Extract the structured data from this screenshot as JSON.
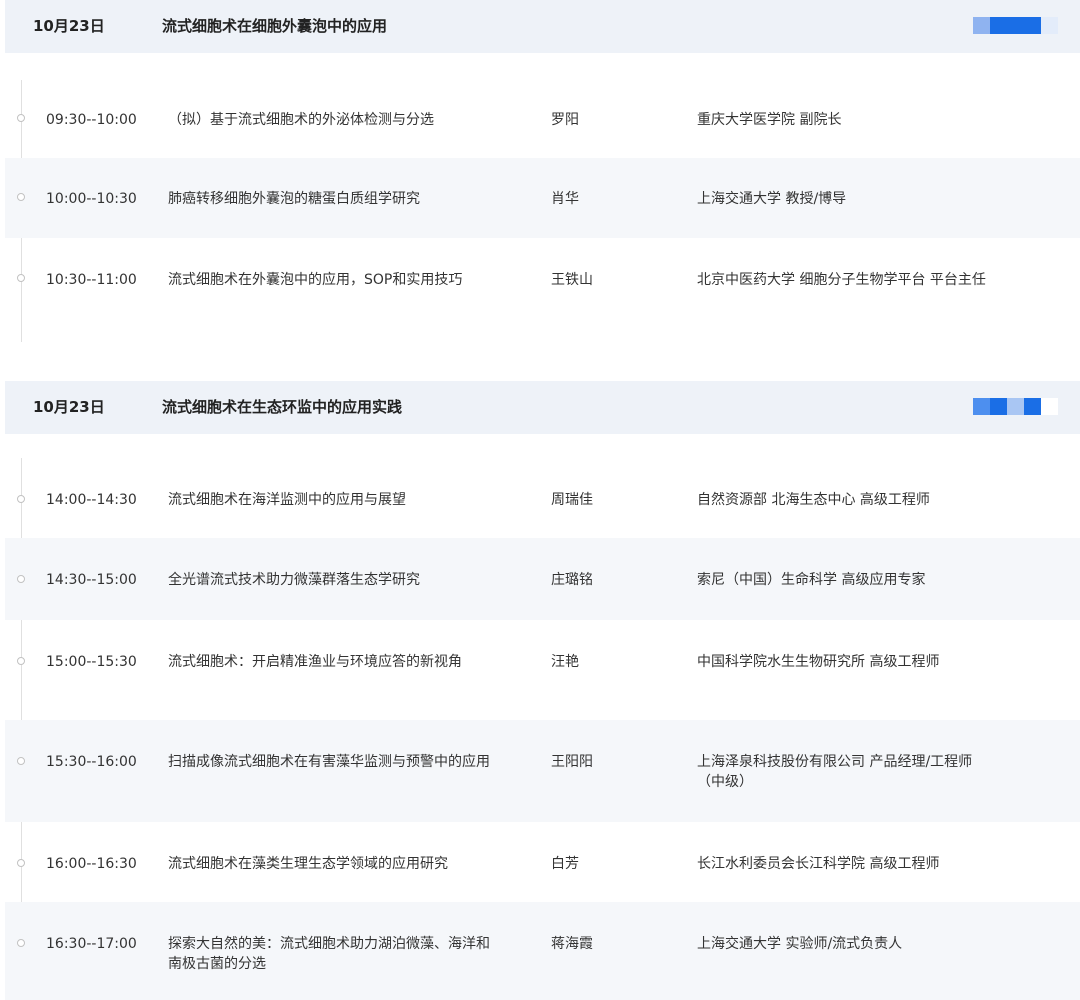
{
  "sections": [
    {
      "date": "10月23日",
      "title": "流式细胞术在细胞外囊泡中的应用",
      "sessions": [
        {
          "time": "09:30--10:00",
          "topic": "（拟）基于流式细胞术的外泌体检测与分选",
          "speaker": "罗阳",
          "org": "重庆大学医学院 副院长"
        },
        {
          "time": "10:00--10:30",
          "topic": "肺癌转移细胞外囊泡的糖蛋白质组学研究",
          "speaker": "肖华",
          "org": "上海交通大学 教授/博导"
        },
        {
          "time": "10:30--11:00",
          "topic": "流式细胞术在外囊泡中的应用，SOP和实用技巧",
          "speaker": "王铁山",
          "org": "北京中医药大学 细胞分子生物学平台 平台主任"
        }
      ]
    },
    {
      "date": "10月23日",
      "title": "流式细胞术在生态环监中的应用实践",
      "sessions": [
        {
          "time": "14:00--14:30",
          "topic": "流式细胞术在海洋监测中的应用与展望",
          "speaker": "周瑞佳",
          "org": "自然资源部 北海生态中心 高级工程师"
        },
        {
          "time": "14:30--15:00",
          "topic": "全光谱流式技术助力微藻群落生态学研究",
          "speaker": "庄璐铭",
          "org": "索尼（中国）生命科学 高级应用专家"
        },
        {
          "time": "15:00--15:30",
          "topic": "流式细胞术：开启精准渔业与环境应答的新视角",
          "speaker": "汪艳",
          "org": "中国科学院水生生物研究所 高级工程师"
        },
        {
          "time": "15:30--16:00",
          "topic": "扫描成像流式细胞术在有害藻华监测与预警中的应用",
          "speaker": "王阳阳",
          "org": "上海泽泉科技股份有限公司 产品经理/工程师（中级）"
        },
        {
          "time": "16:00--16:30",
          "topic": "流式细胞术在藻类生理生态学领域的应用研究",
          "speaker": "白芳",
          "org": "长江水利委员会长江科学院 高级工程师"
        },
        {
          "time": "16:30--17:00",
          "topic": "探索大自然的美：流式细胞术助力湖泊微藻、海洋和南极古菌的分选",
          "speaker": "蒋海霞",
          "org": "上海交通大学 实验师/流式负责人"
        }
      ]
    }
  ],
  "colors": {
    "header_bg": "#eef2f8",
    "row_alt_bg": "#f5f7fa",
    "badge_a": [
      "#8fb3f0",
      "#1a6ee6",
      "#1a6ee6",
      "#1a6ee6",
      "#e3ecfa"
    ],
    "badge_b": [
      "#4d8fef",
      "#1a6ee6",
      "#a9c6f3",
      "#1a6ee6",
      "#ffffff"
    ]
  }
}
